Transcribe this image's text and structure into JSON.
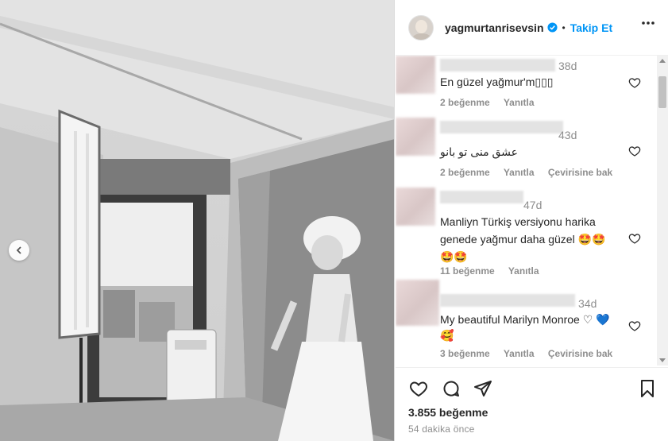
{
  "post": {
    "username": "yagmurtanrisevsin",
    "follow_label": "Takip Et",
    "separator": "•",
    "likes": "3.855 beğenme",
    "time_ago": "54 dakika önce"
  },
  "comments": [
    {
      "time": "38d",
      "text": "En güzel yağmur'm▯▯▯",
      "likes": "2 beğenme",
      "reply": "Yanıtla",
      "translate": ""
    },
    {
      "time": "43d",
      "text": "عشق منی تو بانو",
      "likes": "2 beğenme",
      "reply": "Yanıtla",
      "translate": "Çevirisine bak"
    },
    {
      "time": "47d",
      "text": "Manliyn Türkiş versiyonu harika genede yağmur daha güzel 🤩🤩 🤩🤩",
      "likes": "11 beğenme",
      "reply": "Yanıtla",
      "translate": ""
    },
    {
      "time": "34d",
      "text": "My beautiful Marilyn Monroe ♡ 💙🥰",
      "likes": "3 beğenme",
      "reply": "Yanıtla",
      "translate": "Çevirisine bak"
    }
  ],
  "icons": [
    "verified-badge-icon",
    "more-options-icon",
    "heart-icon",
    "comment-icon",
    "share-icon",
    "bookmark-icon",
    "chevron-left-icon"
  ],
  "colors": {
    "accent": "#0095f6",
    "text": "#262626",
    "muted": "#8e8e8e"
  }
}
